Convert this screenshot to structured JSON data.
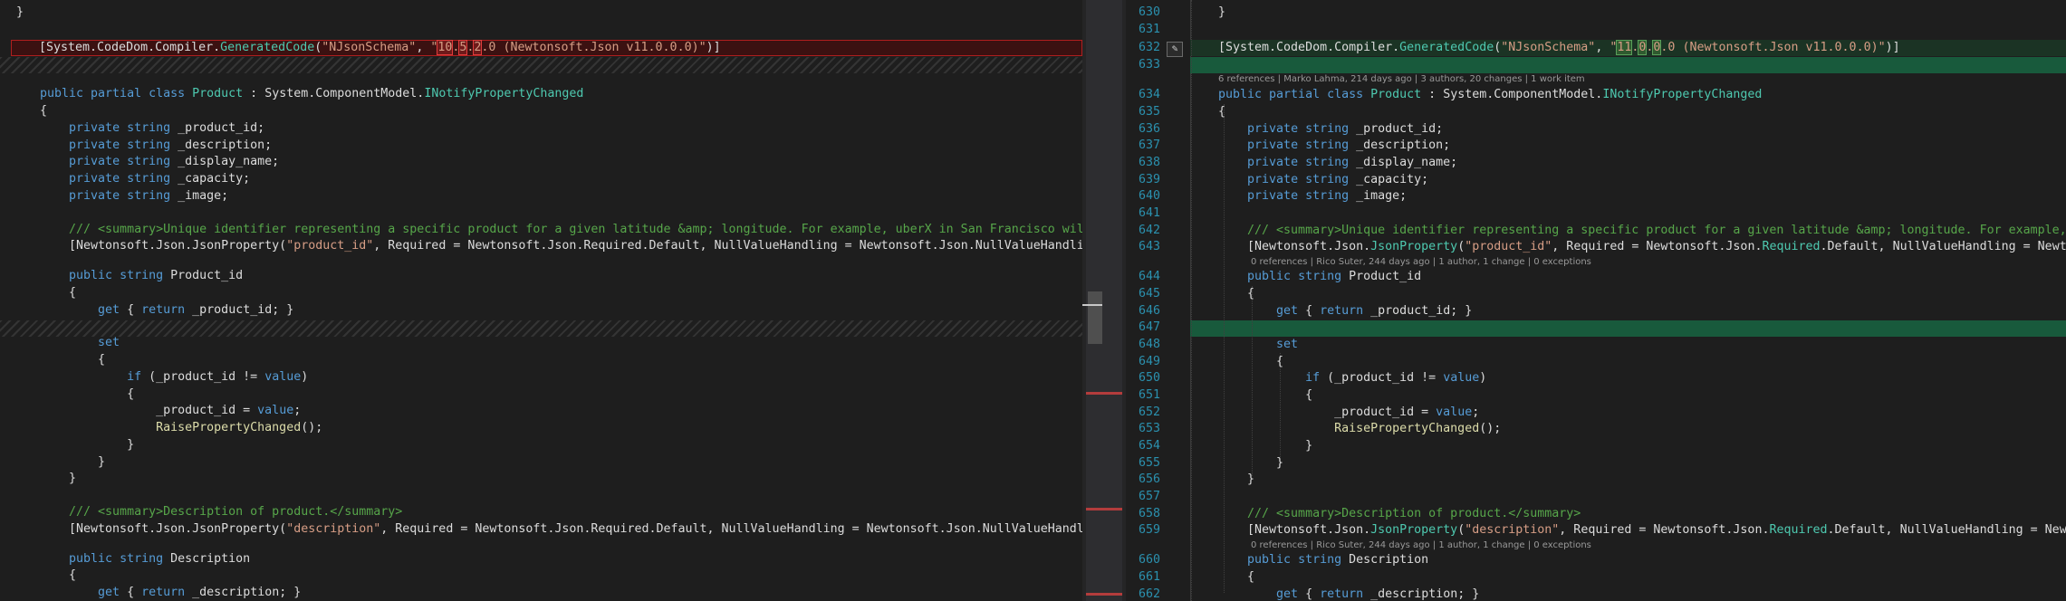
{
  "left": {
    "lines": [
      {
        "t": "}"
      },
      {
        "t": "[System.CodeDom.Compiler.GeneratedCode(\"NJsonSchema\", \"10.5.2.0 (Newtonsoft.Json v11.0.0.0)\")]"
      },
      {
        "t": "public partial class Product : System.ComponentModel.INotifyPropertyChanged"
      },
      {
        "t": "{"
      },
      {
        "t": "    private string _product_id;"
      },
      {
        "t": "    private string _description;"
      },
      {
        "t": "    private string _display_name;"
      },
      {
        "t": "    private string _capacity;"
      },
      {
        "t": "    private string _image;"
      },
      {
        "t": "    /// <summary>Unique identifier representing a specific product for a given latitude &amp; longitude. For example, uberX in San Francisco will h"
      },
      {
        "t": "    [Newtonsoft.Json.JsonProperty(\"product_id\", Required = Newtonsoft.Json.Required.Default, NullValueHandling = Newtonsoft.Json.NullValueHandling."
      },
      {
        "t": "    public string Product_id"
      },
      {
        "t": "    {"
      },
      {
        "t": "        get { return _product_id; }"
      },
      {
        "t": "        set"
      },
      {
        "t": "        {"
      },
      {
        "t": "            if (_product_id != value)"
      },
      {
        "t": "            {"
      },
      {
        "t": "                _product_id = value;"
      },
      {
        "t": "                RaisePropertyChanged();"
      },
      {
        "t": "            }"
      },
      {
        "t": "        }"
      },
      {
        "t": "    /// <summary>Description of product.</summary>"
      },
      {
        "t": "    [Newtonsoft.Json.JsonProperty(\"description\", Required = Newtonsoft.Json.Required.Default, NullValueHandling = Newtonsoft.Json.NullValueHandling"
      },
      {
        "t": "    public string Description"
      },
      {
        "t": "    {"
      },
      {
        "t": "        get { return _description; }"
      }
    ]
  },
  "right": {
    "line_numbers": [
      "630",
      "631",
      "632",
      "633",
      "634",
      "635",
      "636",
      "637",
      "638",
      "639",
      "640",
      "641",
      "642",
      "643",
      "644",
      "645",
      "646",
      "647",
      "648",
      "649",
      "650",
      "651",
      "652",
      "653",
      "654",
      "655",
      "656",
      "657",
      "658",
      "659",
      "660",
      "661",
      "662"
    ],
    "lines": [
      {
        "t": "}"
      },
      {
        "t": "[System.CodeDom.Compiler.GeneratedCode(\"NJsonSchema\", \"11.0.0.0 (Newtonsoft.Json v11.0.0.0)\")]"
      },
      {
        "t": "public partial class Product : System.ComponentModel.INotifyPropertyChanged"
      },
      {
        "t": "{"
      },
      {
        "t": "    private string _product_id;"
      },
      {
        "t": "    private string _description;"
      },
      {
        "t": "    private string _display_name;"
      },
      {
        "t": "    private string _capacity;"
      },
      {
        "t": "    private string _image;"
      },
      {
        "t": "    /// <summary>Unique identifier representing a specific product for a given latitude &amp; longitude. For example, u"
      },
      {
        "t": "    [Newtonsoft.Json.JsonProperty(\"product_id\", Required = Newtonsoft.Json.Required.Default, NullValueHandling = Newtons"
      },
      {
        "t": "    public string Product_id"
      },
      {
        "t": "    {"
      },
      {
        "t": "        get { return _product_id; }"
      },
      {
        "t": "        set"
      },
      {
        "t": "        {"
      },
      {
        "t": "            if (_product_id != value)"
      },
      {
        "t": "            {"
      },
      {
        "t": "                _product_id = value;"
      },
      {
        "t": "                RaisePropertyChanged();"
      },
      {
        "t": "            }"
      },
      {
        "t": "        }"
      },
      {
        "t": "    }"
      },
      {
        "t": "    /// <summary>Description of product.</summary>"
      },
      {
        "t": "    [Newtonsoft.Json.JsonProperty(\"description\", Required = Newtonsoft.Json.Required.Default, NullValueHandling = Newtons"
      },
      {
        "t": "    public string Description"
      },
      {
        "t": "    {"
      },
      {
        "t": "        get { return _description; }"
      }
    ],
    "codelens": [
      {
        "text": "6 references | Marko Lahma, 214 days ago | 3 authors, 20 changes | 1 work item"
      },
      {
        "text": "0 references | Rico Suter, 244 days ago | 1 author, 1 change | 0 exceptions"
      },
      {
        "text": "0 references | Rico Suter, 244 days ago | 1 author, 1 change | 0 exceptions"
      }
    ]
  },
  "icons": {
    "change_marker": "pencil-edit-icon"
  },
  "colors": {
    "removed": "#3b1111",
    "added": "#1b3324",
    "keyword": "#569cd6",
    "type": "#4ec9b0",
    "string": "#d69d85",
    "comment": "#57a64a"
  }
}
